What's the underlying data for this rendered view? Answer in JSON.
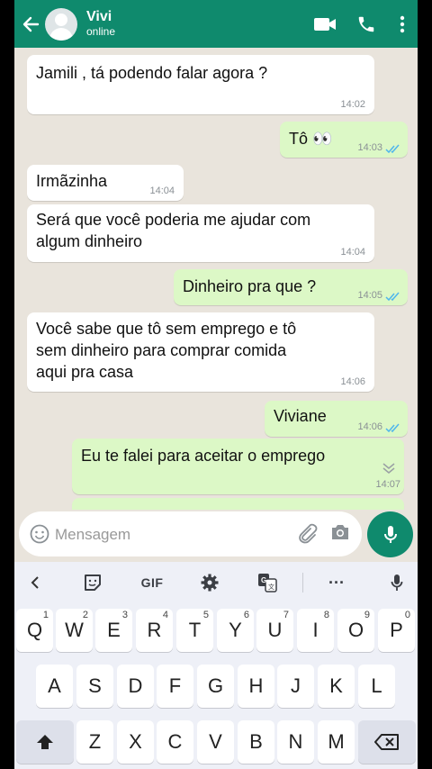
{
  "header": {
    "contact_name": "Vivi",
    "contact_status": "online"
  },
  "messages": [
    {
      "dir": "in",
      "text": "Jamili , tá podendo falar agora ?",
      "time": "14:02"
    },
    {
      "dir": "out",
      "text": "Tô 👀",
      "time": "14:03",
      "read": true
    },
    {
      "dir": "in",
      "text": "Irmãzinha",
      "time": "14:04"
    },
    {
      "dir": "in",
      "text": "Será que você poderia me ajudar com\nalgum dinheiro",
      "time": "14:04"
    },
    {
      "dir": "out",
      "text": "Dinheiro pra que ?",
      "time": "14:05",
      "read": true
    },
    {
      "dir": "in",
      "text": "Você sabe que tô sem emprego e tô\nsem dinheiro para comprar comida\naqui pra casa",
      "time": "14:06"
    },
    {
      "dir": "out",
      "text": "Viviane",
      "time": "14:06",
      "read": true
    },
    {
      "dir": "out",
      "text": "Eu te falei para aceitar o emprego",
      "time": "14:07",
      "read": false
    }
  ],
  "input": {
    "placeholder": "Mensagem",
    "value": ""
  },
  "keyboard": {
    "toolbar": {
      "gif_label": "GIF",
      "more_label": "···"
    },
    "row1": [
      {
        "key": "Q",
        "hint": "1"
      },
      {
        "key": "W",
        "hint": "2"
      },
      {
        "key": "E",
        "hint": "3"
      },
      {
        "key": "R",
        "hint": "4"
      },
      {
        "key": "T",
        "hint": "5"
      },
      {
        "key": "Y",
        "hint": "6"
      },
      {
        "key": "U",
        "hint": "7"
      },
      {
        "key": "I",
        "hint": "8"
      },
      {
        "key": "O",
        "hint": "9"
      },
      {
        "key": "P",
        "hint": "0"
      }
    ],
    "row2": [
      "A",
      "S",
      "D",
      "F",
      "G",
      "H",
      "J",
      "K",
      "L"
    ],
    "row3": [
      "Z",
      "X",
      "C",
      "V",
      "B",
      "N",
      "M"
    ]
  },
  "colors": {
    "header": "#0f8a6d",
    "incoming_bubble": "#ffffff",
    "outgoing_bubble": "#dcf8c6",
    "chat_background": "#e9e4dc",
    "read_ticks": "#4fb6ec",
    "keyboard_bg": "#eef0f7"
  },
  "icons": {
    "header": [
      "back-arrow-icon",
      "avatar",
      "video-call-icon",
      "phone-icon",
      "more-vert-icon"
    ],
    "input": [
      "emoji-icon",
      "attach-icon",
      "camera-icon",
      "mic-icon"
    ],
    "keyboard_toolbar": [
      "chevron-left-icon",
      "sticker-icon",
      "gif",
      "settings-icon",
      "translate-icon",
      "more-icon",
      "mic-icon"
    ]
  }
}
